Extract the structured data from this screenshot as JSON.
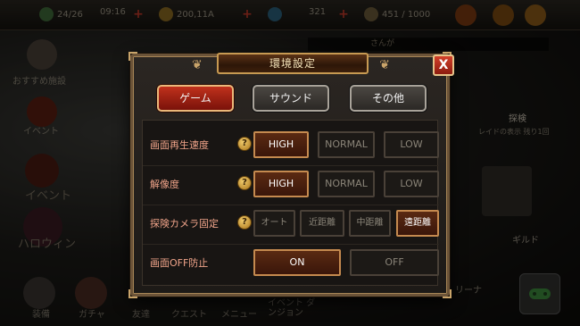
{
  "hud": {
    "stamina": "24/26",
    "stamina_timer": "09:16",
    "gold": "200,11A",
    "gems": "321",
    "medals": "451 / 1000",
    "notice_text": "さんが"
  },
  "side_menu": {
    "recommended": "おすすめ施設",
    "event": "イベント",
    "event2": "イベント",
    "halloween": "ハロウィン",
    "explore": "探検",
    "explore_sub": "レイドの表示 残り1回",
    "guild": "ギルド",
    "arena": "リーナ"
  },
  "bottom_menu": {
    "equip": "装備",
    "gacha": "ガチャ",
    "friends": "友達",
    "quest": "クエスト",
    "menu": "メニュー",
    "event_dungeon": "イベント ダンジョン"
  },
  "dialog": {
    "title": "環境設定",
    "close_label": "X",
    "tabs": {
      "game": "ゲーム",
      "sound": "サウンド",
      "other": "その他"
    },
    "settings": {
      "playback_speed": {
        "label": "画面再生速度",
        "options": [
          "HIGH",
          "NORMAL",
          "LOW"
        ],
        "selected": "HIGH"
      },
      "resolution": {
        "label": "解像度",
        "options": [
          "HIGH",
          "NORMAL",
          "LOW"
        ],
        "selected": "HIGH"
      },
      "camera_lock": {
        "label": "探険カメラ固定",
        "options": [
          "オート",
          "近距離",
          "中距離",
          "遠距離"
        ],
        "selected": "遠距離"
      },
      "screen_off": {
        "label": "画面OFF防止",
        "options": [
          "ON",
          "OFF"
        ],
        "selected": "ON"
      }
    },
    "help_icon_text": "?"
  },
  "colors": {
    "accent_red": "#c0311c",
    "gold_border": "#c9a46a",
    "label_salmon": "#f0a48a"
  }
}
